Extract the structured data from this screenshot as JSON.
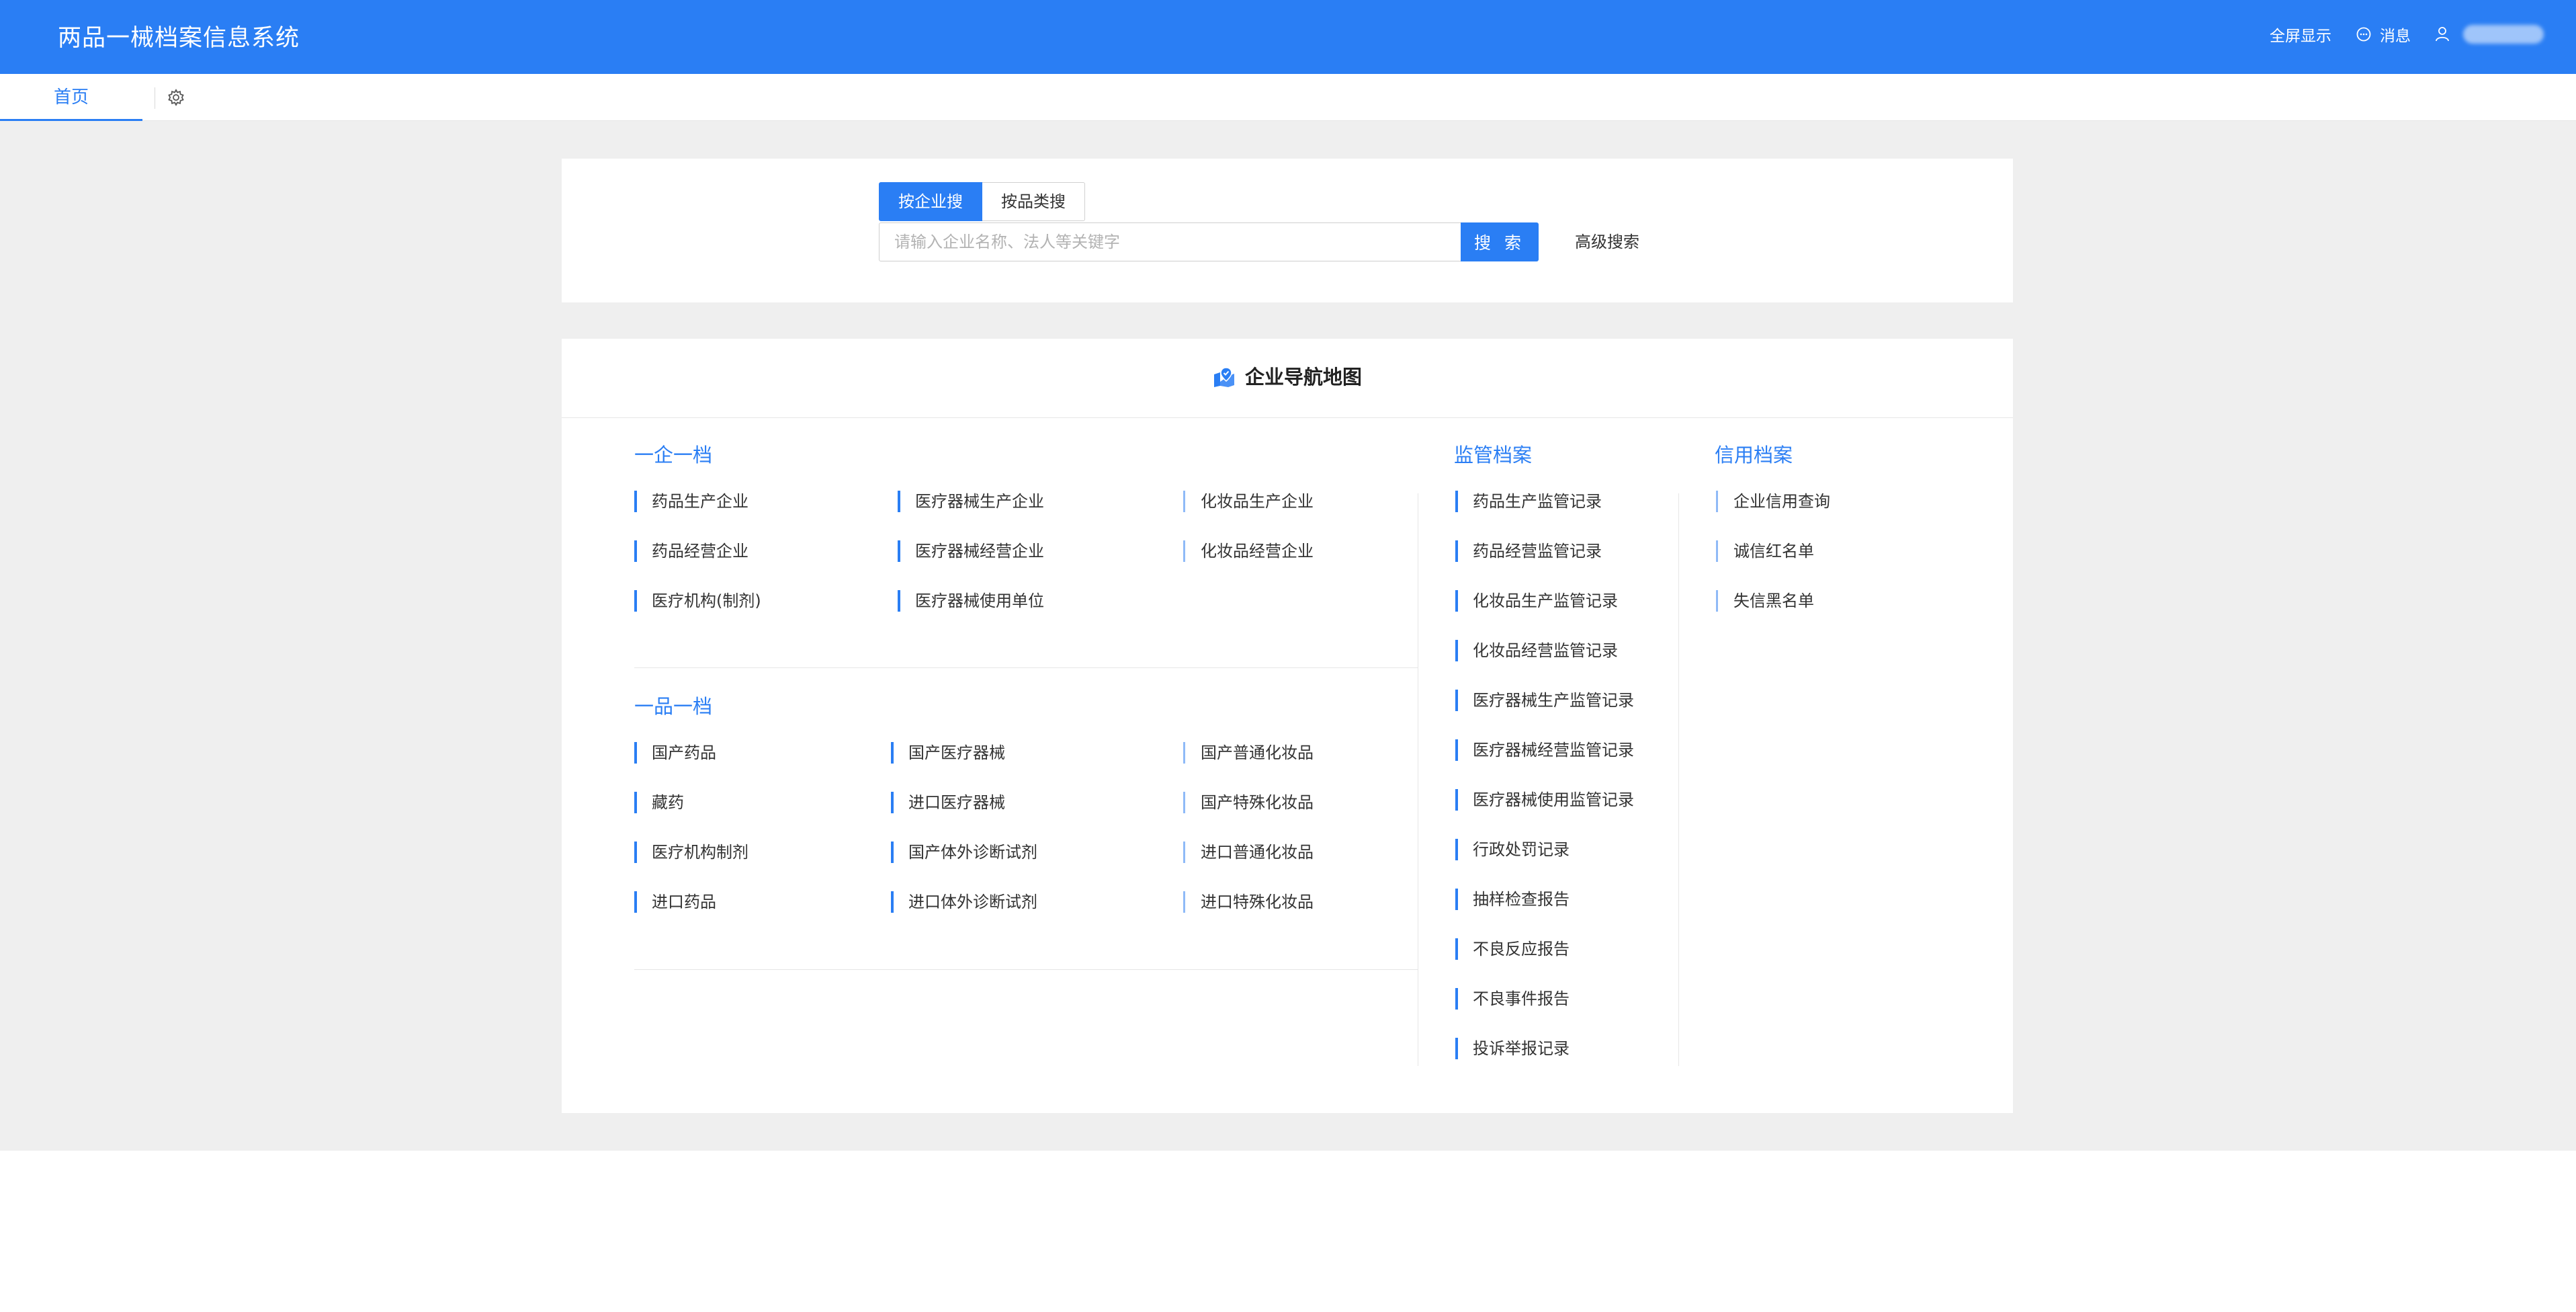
{
  "header": {
    "title": "两品一械档案信息系统",
    "fullscreen_label": "全屏显示",
    "message_label": "消息"
  },
  "tabs": {
    "home_label": "首页"
  },
  "search": {
    "tab_enterprise": "按企业搜",
    "tab_product": "按品类搜",
    "placeholder": "请输入企业名称、法人等关键字",
    "button_label": "搜 索",
    "advanced_label": "高级搜索"
  },
  "nav": {
    "title": "企业导航地图",
    "enterprise_archive": {
      "title": "一企一档",
      "items": [
        "药品生产企业",
        "医疗器械生产企业",
        "化妆品生产企业",
        "药品经营企业",
        "医疗器械经营企业",
        "化妆品经营企业",
        "医疗机构(制剂)",
        "医疗器械使用单位"
      ]
    },
    "product_archive": {
      "title": "一品一档",
      "items": [
        "国产药品",
        "国产医疗器械",
        "国产普通化妆品",
        "藏药",
        "进口医疗器械",
        "国产特殊化妆品",
        "医疗机构制剂",
        "国产体外诊断试剂",
        "进口普通化妆品",
        "进口药品",
        "进口体外诊断试剂",
        "进口特殊化妆品"
      ]
    },
    "supervision_archive": {
      "title": "监管档案",
      "items": [
        "药品生产监管记录",
        "药品经营监管记录",
        "化妆品生产监管记录",
        "化妆品经营监管记录",
        "医疗器械生产监管记录",
        "医疗器械经营监管记录",
        "医疗器械使用监管记录",
        "行政处罚记录",
        "抽样检查报告",
        "不良反应报告",
        "不良事件报告",
        "投诉举报记录"
      ]
    },
    "credit_archive": {
      "title": "信用档案",
      "items": [
        "企业信用查询",
        "诚信红名单",
        "失信黑名单"
      ]
    }
  },
  "colors": {
    "primary": "#2a7ef4",
    "background": "#efefef"
  },
  "icons": [
    "fullscreen",
    "message-icon",
    "user-icon",
    "gear-icon",
    "map-pin-icon"
  ]
}
